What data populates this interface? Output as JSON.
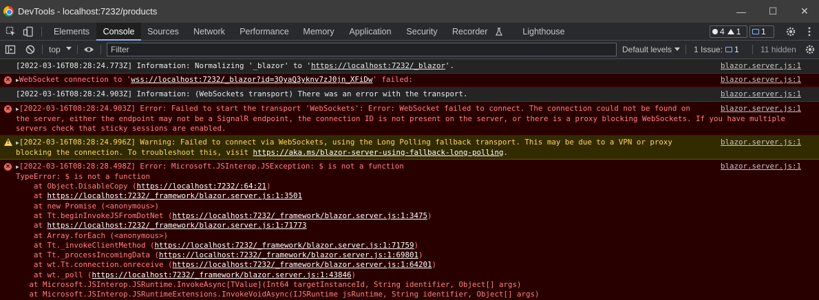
{
  "window": {
    "title": "DevTools - localhost:7232/products",
    "minimize": "—",
    "maximize": "☐",
    "close": "✕"
  },
  "tabs": {
    "items": [
      "Elements",
      "Console",
      "Sources",
      "Network",
      "Performance",
      "Memory",
      "Application",
      "Security",
      "Recorder",
      "Lighthouse"
    ],
    "active": "Console",
    "errors_count": "4",
    "warnings_count": "1",
    "messages_count": "1"
  },
  "toolbar": {
    "context": "top",
    "filter_placeholder": "Filter",
    "levels": "Default levels",
    "issues_label": "1 Issue:",
    "issues_count": "1",
    "hidden": "11 hidden"
  },
  "colors": {
    "accent": "#8ab4f8",
    "error_bg": "#290000",
    "error_text": "#ff8080",
    "warning_bg": "#332b00",
    "warning_text": "#fdd663"
  },
  "console": {
    "msg1": {
      "prefix": "[2022-03-16T08:28:24.773Z] Information: Normalizing '_blazor' to '",
      "link": "https://localhost:7232/_blazor",
      "suffix": "'.",
      "source": "blazor.server.js:1"
    },
    "msg2": {
      "prefix": "WebSocket connection to '",
      "link": "wss://localhost:7232/_blazor?id=3OyaQ3yknv7zJ0jn_XFiDw",
      "suffix": "' failed:",
      "source": "blazor.server.js:1"
    },
    "msg3": {
      "text": "[2022-03-16T08:28:24.903Z] Information: (WebSockets transport) There was an error with the transport.",
      "source": "blazor.server.js:1"
    },
    "msg4": {
      "line1": "[2022-03-16T08:28:24.903Z] Error: Failed to start the transport 'WebSockets': Error: WebSocket failed to connect. The connection could not be found on",
      "line2": "the server, either the endpoint may not be a SignalR endpoint, the connection ID is not present on the server, or there is a proxy blocking WebSockets. If you have multiple",
      "line3": "servers check that sticky sessions are enabled.",
      "source": "blazor.server.js:1"
    },
    "msg5": {
      "line1": "[2022-03-16T08:28:24.996Z] Warning: Failed to connect via WebSockets, using the Long Polling fallback transport. This may be due to a VPN or proxy",
      "line2_prefix": "blocking the connection. To troubleshoot this, visit ",
      "line2_link": "https://aka.ms/blazor-server-using-fallback-long-polling",
      "line2_suffix": ".",
      "source": "blazor.server.js:1"
    },
    "msg6": {
      "line1": "[2022-03-16T08:28:28.498Z] Error: Microsoft.JSInterop.JSException: $ is not a function",
      "line2": "TypeError: $ is not a function",
      "source": "blazor.server.js:1",
      "stack": [
        {
          "pre": "    at Object.DisableCopy (",
          "link": "https://localhost:7232/:64:21",
          "post": ")"
        },
        {
          "pre": "    at ",
          "link": "https://localhost:7232/_framework/blazor.server.js:1:3501",
          "post": ""
        },
        {
          "pre": "    at new Promise (<anonymous>)",
          "link": "",
          "post": ""
        },
        {
          "pre": "    at Tt.beginInvokeJSFromDotNet (",
          "link": "https://localhost:7232/_framework/blazor.server.js:1:3475",
          "post": ")"
        },
        {
          "pre": "    at ",
          "link": "https://localhost:7232/_framework/blazor.server.js:1:71773",
          "post": ""
        },
        {
          "pre": "    at Array.forEach (<anonymous>)",
          "link": "",
          "post": ""
        },
        {
          "pre": "    at Tt._invokeClientMethod (",
          "link": "https://localhost:7232/_framework/blazor.server.js:1:71759",
          "post": ")"
        },
        {
          "pre": "    at Tt._processIncomingData (",
          "link": "https://localhost:7232/_framework/blazor.server.js:1:69801",
          "post": ")"
        },
        {
          "pre": "    at wt.Tt.connection.onreceive (",
          "link": "https://localhost:7232/_framework/blazor.server.js:1:64201",
          "post": ")"
        },
        {
          "pre": "    at wt._poll (",
          "link": "https://localhost:7232/_framework/blazor.server.js:1:43846",
          "post": ")"
        },
        {
          "pre": "   at Microsoft.JSInterop.JSRuntime.InvokeAsync[TValue](Int64 targetInstanceId, String identifier, Object[] args)",
          "link": "",
          "post": ""
        },
        {
          "pre": "   at Microsoft.JSInterop.JSRuntimeExtensions.InvokeVoidAsync(IJSRuntime jsRuntime, String identifier, Object[] args)",
          "link": "",
          "post": ""
        }
      ]
    }
  }
}
